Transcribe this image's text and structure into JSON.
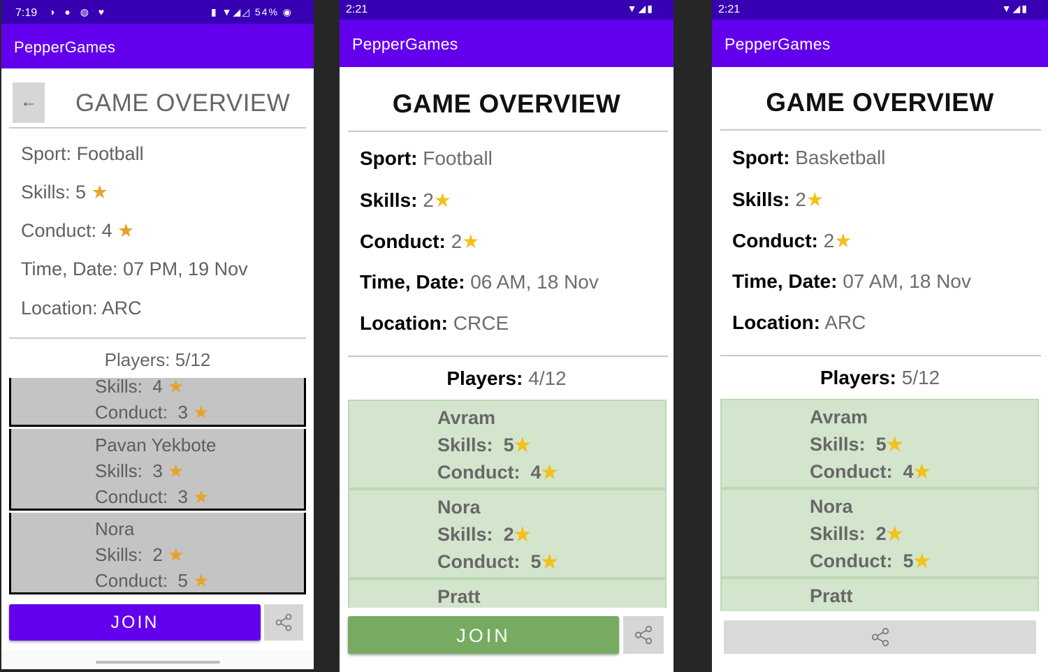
{
  "app_name": "PepperGames",
  "screens": [
    {
      "status": {
        "time": "7:19",
        "left_icons": "◑ ● ◍ ♥",
        "right_icons": "▮ ▼◢◿ 54% ◉"
      },
      "back_icon": "←",
      "title": "GAME OVERVIEW",
      "info": {
        "sport_label": "Sport:",
        "sport": "Football",
        "skills_label": "Skills:",
        "skills": "5",
        "conduct_label": "Conduct:",
        "conduct": "4",
        "time_label": "Time, Date:",
        "time": "07 PM, 19 Nov",
        "location_label": "Location:",
        "location": "ARC"
      },
      "players_label": "Players:",
      "players": "5/12",
      "players_list": [
        {
          "skills_label": "Skills:",
          "skills": "4",
          "conduct_label": "Conduct:",
          "conduct": "3"
        },
        {
          "name": "Pavan Yekbote",
          "skills_label": "Skills:",
          "skills": "3",
          "conduct_label": "Conduct:",
          "conduct": "3"
        },
        {
          "name": "Nora",
          "skills_label": "Skills:",
          "skills": "2",
          "conduct_label": "Conduct:",
          "conduct": "5"
        }
      ],
      "join_label": "JOIN",
      "share_icon": "share-icon"
    },
    {
      "status": {
        "time": "2:21",
        "right_icons": "▼◢▮"
      },
      "title": "GAME OVERVIEW",
      "info": {
        "sport_label": "Sport:",
        "sport": "Football",
        "skills_label": "Skills:",
        "skills": "2",
        "conduct_label": "Conduct:",
        "conduct": "2",
        "time_label": "Time, Date:",
        "time": "06 AM, 18 Nov",
        "location_label": "Location:",
        "location": "CRCE"
      },
      "players_label": "Players:",
      "players": "4/12",
      "players_list": [
        {
          "name": "Avram",
          "skills_label": "Skills:",
          "skills": "5",
          "conduct_label": "Conduct:",
          "conduct": "4"
        },
        {
          "name": "Nora",
          "skills_label": "Skills:",
          "skills": "2",
          "conduct_label": "Conduct:",
          "conduct": "5"
        },
        {
          "name": "Pratt"
        }
      ],
      "join_label": "JOIN",
      "share_icon": "share-icon"
    },
    {
      "status": {
        "time": "2:21",
        "right_icons": "▼◢▮"
      },
      "title": "GAME OVERVIEW",
      "info": {
        "sport_label": "Sport:",
        "sport": "Basketball",
        "skills_label": "Skills:",
        "skills": "2",
        "conduct_label": "Conduct:",
        "conduct": "2",
        "time_label": "Time, Date:",
        "time": "07 AM, 18 Nov",
        "location_label": "Location:",
        "location": "ARC"
      },
      "players_label": "Players:",
      "players": "5/12",
      "players_list": [
        {
          "name": "Avram",
          "skills_label": "Skills:",
          "skills": "5",
          "conduct_label": "Conduct:",
          "conduct": "4"
        },
        {
          "name": "Nora",
          "skills_label": "Skills:",
          "skills": "2",
          "conduct_label": "Conduct:",
          "conduct": "5"
        },
        {
          "name": "Pratt"
        }
      ],
      "share_icon": "share-icon"
    }
  ],
  "colors": {
    "status_bar": "#3700b3",
    "app_bar": "#6200ee",
    "join_purple": "#6200ee",
    "join_green": "#77ab61",
    "player_card_green": "#d3e5cd",
    "player_card_gray": "#c4c4c4",
    "star": "#f2c11c"
  },
  "icons": {
    "star": "★",
    "share": "⪪",
    "back": "←"
  }
}
